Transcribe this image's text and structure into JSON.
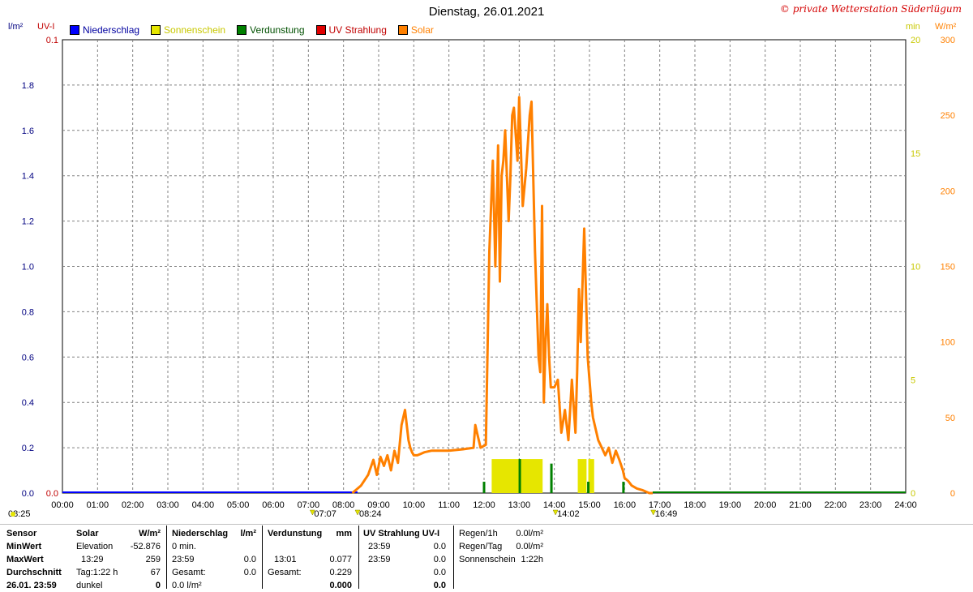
{
  "header": {
    "title": "Dienstag, 26.01.2021",
    "copyright": "© private Wetterstation Süderlügum"
  },
  "units": {
    "left1": "l/m²",
    "left2": "UV-I",
    "right1": "min",
    "right2": "W/m²"
  },
  "legend": [
    {
      "label": "Niederschlag",
      "color": "#0000ff",
      "text_color": "#0000a0"
    },
    {
      "label": "Sonnenschein",
      "color": "#e6e600",
      "text_color": "#c8c800"
    },
    {
      "label": "Verdunstung",
      "color": "#008000",
      "text_color": "#005000"
    },
    {
      "label": "UV Strahlung",
      "color": "#e00000",
      "text_color": "#c00000"
    },
    {
      "label": "Solar",
      "color": "#ff8000",
      "text_color": "#ff8000"
    }
  ],
  "colors": {
    "grid": "#808080",
    "left_axis": "#000080",
    "uv_axis": "#c00000",
    "min_axis": "#c8c800",
    "solar_axis": "#ff8000",
    "solar": "#ff8000",
    "sun": "#e6e600",
    "evap": "#008000",
    "rain": "#0000ff"
  },
  "chart_data": {
    "type": "line",
    "title": "Dienstag, 26.01.2021",
    "x_ticks": [
      "00:00",
      "01:00",
      "02:00",
      "03:00",
      "04:00",
      "05:00",
      "06:00",
      "07:00",
      "08:00",
      "09:00",
      "10:00",
      "11:00",
      "12:00",
      "13:00",
      "14:00",
      "15:00",
      "16:00",
      "17:00",
      "18:00",
      "19:00",
      "20:00",
      "21:00",
      "22:00",
      "23:00",
      "24:00"
    ],
    "xlim_hours": [
      0,
      24
    ],
    "axes": {
      "rain_lm2": {
        "ticks": [
          "0.0",
          "0.2",
          "0.4",
          "0.6",
          "0.8",
          "1.0",
          "1.2",
          "1.4",
          "1.6",
          "1.8"
        ],
        "range": [
          0,
          2.0
        ]
      },
      "uv_index": {
        "ticks": [
          "0.0",
          "0.1"
        ],
        "range": [
          0,
          0.1
        ]
      },
      "sunshine_min": {
        "ticks": [
          "0",
          "5",
          "10",
          "15",
          "20"
        ],
        "range": [
          0,
          20
        ]
      },
      "solar_wm2": {
        "ticks": [
          "0",
          "50",
          "100",
          "150",
          "200",
          "250",
          "300"
        ],
        "range": [
          0,
          300
        ]
      }
    },
    "grid": true,
    "series": [
      {
        "name": "Solar",
        "axis": "solar_wm2",
        "x": [
          8.25,
          8.5,
          8.7,
          8.85,
          8.95,
          9.05,
          9.15,
          9.25,
          9.35,
          9.45,
          9.55,
          9.65,
          9.75,
          9.85,
          9.9,
          9.95,
          10.0,
          10.1,
          10.2,
          10.3,
          10.5,
          11.0,
          11.4,
          11.7,
          11.75,
          11.8,
          11.9,
          12.05,
          12.15,
          12.25,
          12.32,
          12.4,
          12.45,
          12.5,
          12.55,
          12.6,
          12.7,
          12.75,
          12.8,
          12.85,
          12.95,
          13.0,
          13.1,
          13.2,
          13.3,
          13.35,
          13.45,
          13.55,
          13.6,
          13.65,
          13.7,
          13.75,
          13.8,
          13.85,
          13.9,
          14.0,
          14.1,
          14.2,
          14.3,
          14.4,
          14.5,
          14.6,
          14.65,
          14.7,
          14.75,
          14.85,
          14.95,
          15.0,
          15.05,
          15.1,
          15.25,
          15.35,
          15.45,
          15.55,
          15.65,
          15.75,
          15.85,
          15.95,
          16.0,
          16.1,
          16.2,
          16.35,
          16.5,
          16.6,
          16.7,
          16.8
        ],
        "y": [
          0,
          5,
          12,
          22,
          12,
          24,
          18,
          25,
          15,
          28,
          20,
          45,
          55,
          35,
          30,
          27,
          25,
          25,
          26,
          27,
          28,
          28,
          29,
          30,
          45,
          40,
          30,
          32,
          160,
          220,
          150,
          230,
          140,
          210,
          220,
          240,
          180,
          210,
          250,
          255,
          220,
          262,
          190,
          215,
          250,
          259,
          160,
          90,
          80,
          190,
          60,
          100,
          125,
          90,
          70,
          70,
          75,
          40,
          55,
          35,
          75,
          40,
          80,
          135,
          100,
          175,
          90,
          75,
          60,
          50,
          35,
          30,
          25,
          30,
          20,
          28,
          22,
          15,
          10,
          8,
          5,
          3,
          2,
          1,
          0,
          0
        ]
      }
    ],
    "sunshine_bars": [
      {
        "start": "12:13",
        "end": "13:40"
      },
      {
        "start": "14:40",
        "end": "14:55"
      },
      {
        "start": "14:58",
        "end": "15:08"
      }
    ],
    "evaporation_spikes": [
      {
        "time": "12:00",
        "height": 0.5
      },
      {
        "time": "13:01",
        "height": 1.5
      },
      {
        "time": "13:55",
        "height": 1.3
      },
      {
        "time": "14:58",
        "height": 0.5
      },
      {
        "time": "15:58",
        "height": 0.5
      }
    ],
    "markers": [
      {
        "label": "08:25",
        "at": "left"
      },
      {
        "label": "07:07",
        "at": "07:07"
      },
      {
        "label": "08:24",
        "at": "08:24"
      },
      {
        "label": "14:02",
        "at": "14:02"
      },
      {
        "label": "16:49",
        "at": "16:49"
      }
    ]
  },
  "table": {
    "col_sensor": [
      "Sensor",
      "MinWert",
      "MaxWert",
      "Durchschnitt",
      "26.01. 23:59"
    ],
    "solar": {
      "header": "Solar",
      "unit": "W/m²",
      "rows": [
        [
          "Elevation",
          "-52.876"
        ],
        [
          "13:29",
          "259"
        ],
        [
          "Tag:1:22 h",
          "67"
        ],
        [
          "dunkel",
          "0"
        ]
      ]
    },
    "rain": {
      "header": "Niederschlag",
      "unit": "l/m²",
      "rows": [
        [
          "0 min.",
          ""
        ],
        [
          "23:59",
          "0.0"
        ],
        [
          "Gesamt:",
          "0.0"
        ],
        [
          "0.0 l/m²",
          ""
        ]
      ]
    },
    "evap": {
      "header": "Verdunstung",
      "unit": "mm",
      "rows": [
        [
          "",
          ""
        ],
        [
          "13:01",
          "0.077"
        ],
        [
          "Gesamt:",
          "0.229"
        ],
        [
          "",
          "0.000"
        ]
      ]
    },
    "uv": {
      "header": "UV Strahlung UV-I",
      "rows": [
        [
          "23:59",
          "0.0"
        ],
        [
          "23:59",
          "0.0"
        ],
        [
          "",
          "0.0"
        ],
        [
          "",
          "0.0"
        ]
      ]
    },
    "regen": {
      "rows": [
        [
          "Regen/1h",
          "0.0l/m²"
        ],
        [
          "Regen/Tag",
          "0.0l/m²"
        ],
        [
          "Sonnenschein",
          "1:22h"
        ]
      ]
    }
  }
}
